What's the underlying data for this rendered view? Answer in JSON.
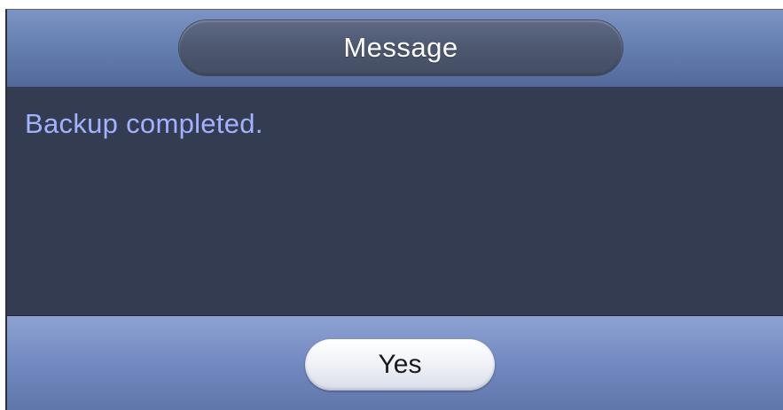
{
  "dialog": {
    "title": "Message",
    "message": "Backup completed.",
    "buttons": {
      "yes_label": "Yes"
    }
  },
  "colors": {
    "title_bar": "#6680b2",
    "body_background": "#343c52",
    "message_text": "#a2b2ff",
    "footer_bar": "#7289c0"
  }
}
